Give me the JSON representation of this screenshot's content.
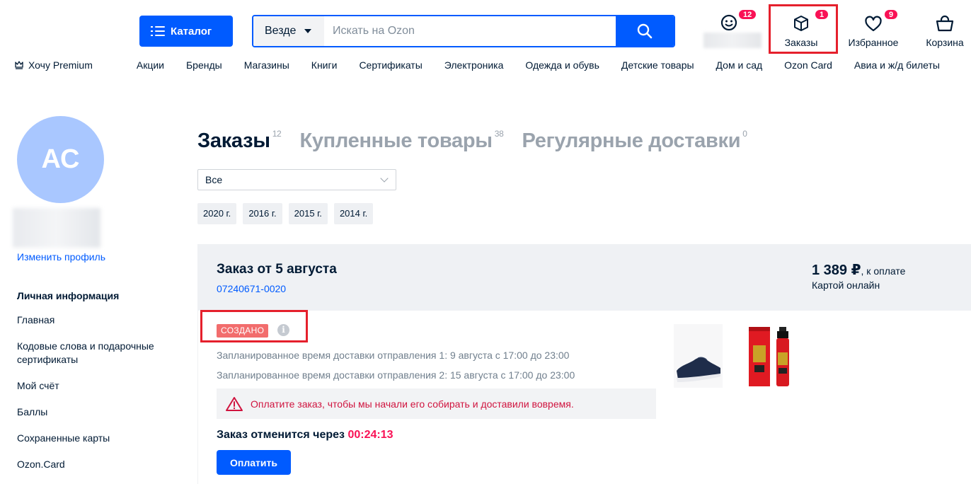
{
  "header": {
    "catalog_label": "Каталог",
    "search_scope": "Везде",
    "search_placeholder": "Искать на Ozon",
    "profile_badge": "12",
    "orders_label": "Заказы",
    "orders_badge": "1",
    "favorites_label": "Избранное",
    "favorites_badge": "9",
    "cart_label": "Корзина"
  },
  "nav": [
    "Хочу Premium",
    "Акции",
    "Бренды",
    "Магазины",
    "Книги",
    "Сертификаты",
    "Электроника",
    "Одежда и обувь",
    "Детские товары",
    "Дом и сад",
    "Ozon Card",
    "Авиа и ж/д билеты"
  ],
  "profile": {
    "initials": "АС",
    "edit_label": "Изменить профиль"
  },
  "sidebar": {
    "title": "Личная информация",
    "items": [
      "Главная",
      "Кодовые слова и подарочные сертификаты",
      "Мой счёт",
      "Баллы",
      "Сохраненные карты",
      "Ozon.Card"
    ]
  },
  "tabs": [
    {
      "label": "Заказы",
      "count": "12"
    },
    {
      "label": "Купленные товары",
      "count": "38"
    },
    {
      "label": "Регулярные доставки",
      "count": "0"
    }
  ],
  "filter": {
    "selected": "Все",
    "years": [
      "2020 г.",
      "2016 г.",
      "2015 г.",
      "2014 г."
    ]
  },
  "order": {
    "title": "Заказ от 5 августа",
    "number": "07240671-0020",
    "price": "1 389 ₽",
    "price_note": ", к оплате",
    "payment": "Картой онлайн",
    "status": "СОЗДАНО",
    "shipments": [
      "Запланированное время доставки отправления 1: 9 августа с 17:00 до 23:00",
      "Запланированное время доставки отправления 2: 15 августа с 17:00 до 23:00"
    ],
    "warning": "Оплатите заказ, чтобы мы начали его собирать и доставили вовремя.",
    "cancel_text": "Заказ отменится через ",
    "cancel_timer": "00:24:13",
    "pay_label": "Оплатить"
  },
  "colors": {
    "brand": "#005bff",
    "accent_pink": "#f91155",
    "status": "#f26d6d",
    "highlight_box": "#e5202c"
  }
}
